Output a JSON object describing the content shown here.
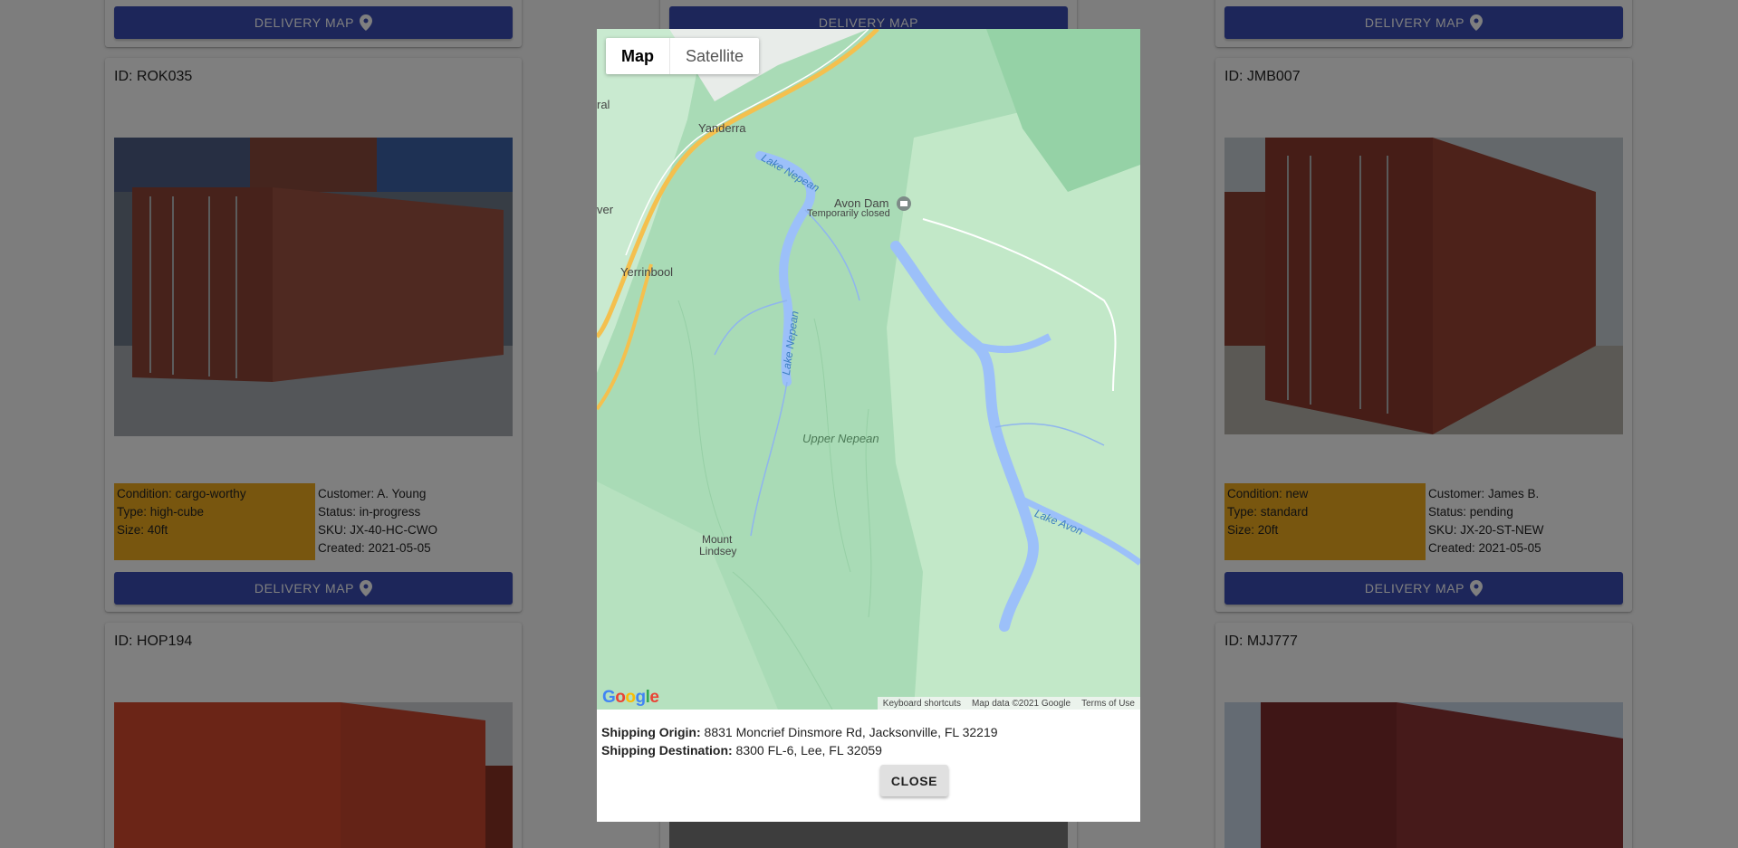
{
  "delivery_button_label": "DELIVERY MAP",
  "cards": [
    {
      "id_text": "ID: ROK035",
      "condition": "Condition: cargo-worthy",
      "type": "Type: high-cube",
      "size": "Size: 40ft",
      "customer": "Customer: A. Young",
      "status": "Status: in-progress",
      "sku": "SKU: JX-40-HC-CWO",
      "created": "Created: 2021-05-05"
    },
    {
      "id_text": "ID: JMB007",
      "condition": "Condition: new",
      "type": "Type: standard",
      "size": "Size: 20ft",
      "customer": "Customer: James B.",
      "status": "Status: pending",
      "sku": "SKU: JX-20-ST-NEW",
      "created": "Created: 2021-05-05"
    },
    {
      "id_text": "ID: HOP194"
    },
    {
      "id_text": "ID: MJJ777"
    }
  ],
  "modal": {
    "map_type_options": [
      "Map",
      "Satellite"
    ],
    "selected_map_type": "Map",
    "map_labels": {
      "yanderra": "Yanderra",
      "yerrinbool": "Yerrinbool",
      "avon_dam": "Avon Dam",
      "avon_dam_status": "Temporarily closed",
      "lake_nepean": "Lake Nepean",
      "upper_nepean": "Upper Nepean",
      "lake_avon": "Lake Avon",
      "mount_lindsey_1": "Mount",
      "mount_lindsey_2": "Lindsey",
      "edge_left_1": "ral",
      "edge_left_2": "ver"
    },
    "google_logo": "Google",
    "footer_links": {
      "keyboard": "Keyboard shortcuts",
      "map_data": "Map data ©2021 Google",
      "terms": "Terms of Use"
    },
    "origin_label": "Shipping Origin:",
    "origin_value": "8831 Moncrief Dinsmore Rd, Jacksonville, FL 32219",
    "destination_label": "Shipping Destination:",
    "destination_value": "8300 FL-6, Lee, FL 32059",
    "close_label": "CLOSE"
  },
  "colors": {
    "button_blue": "#3a4cb5",
    "condition_bg": "#f1ad1f",
    "overlay": "rgba(0,0,0,0.5)",
    "map_green": "#a8dab5",
    "water_blue": "#9cc0f9"
  }
}
